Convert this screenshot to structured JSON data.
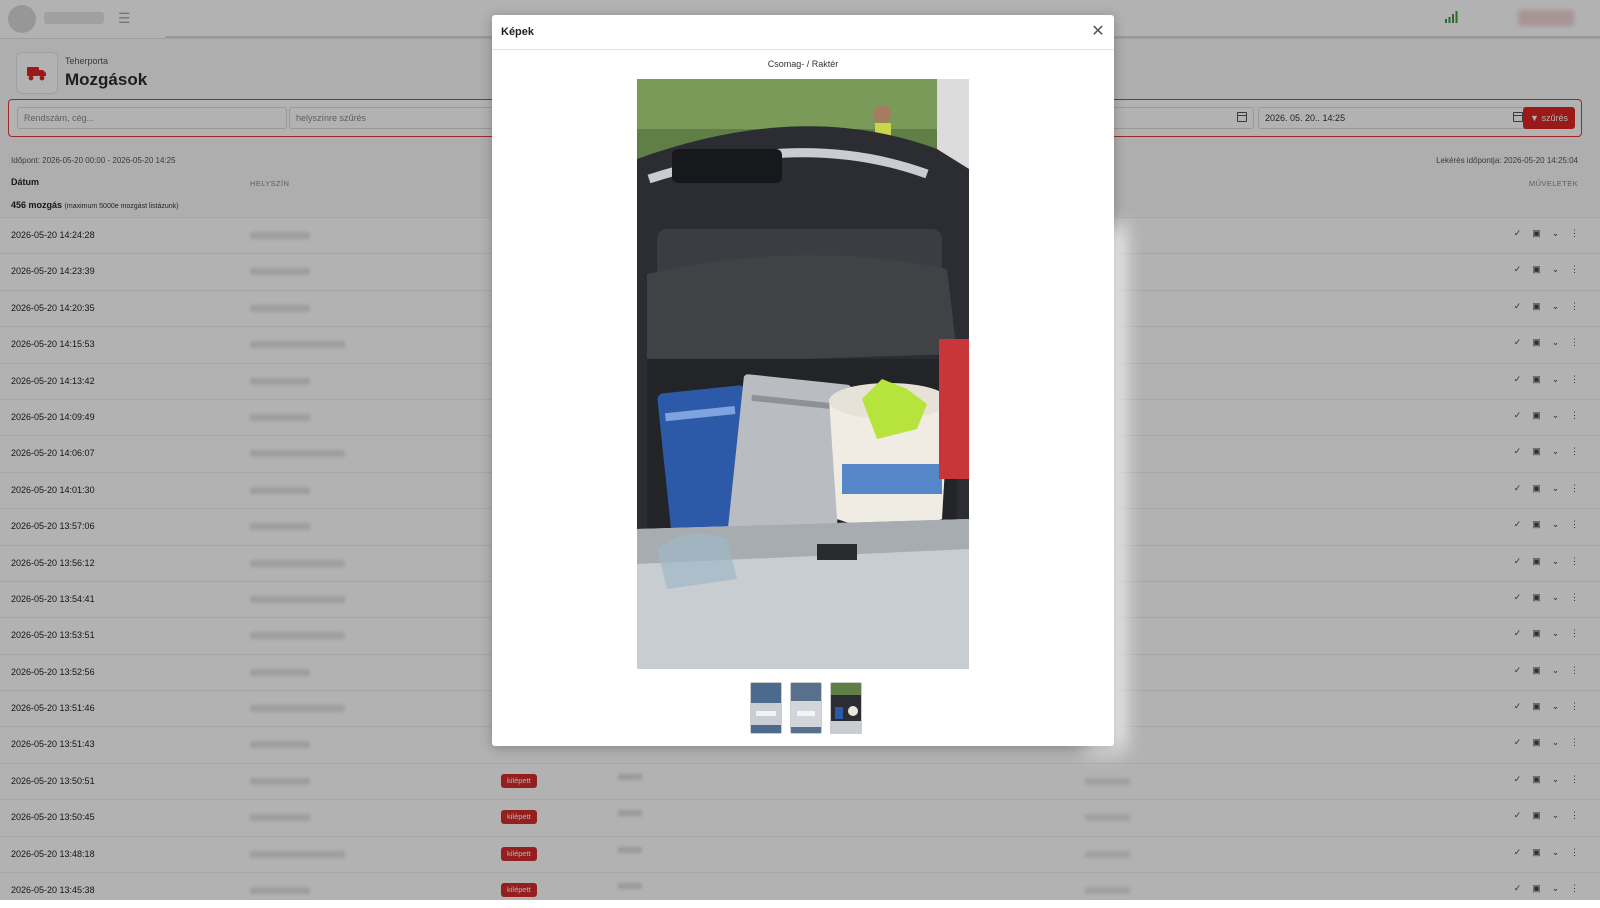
{
  "header": {
    "breadcrumb": "Teherporta",
    "title": "Mozgások"
  },
  "filters": {
    "search_placeholder": "Rendszám, cég...",
    "location_placeholder": "helyszínre szűrés",
    "date_to": "2026. 05. 20.. 14:25",
    "filter_button": "szűrés"
  },
  "meta": {
    "period": "Időpont: 2026-05-20 00:00 - 2026-05-20 14:25",
    "query_time": "Lekérés időpontja: 2026-05-20 14:25:04"
  },
  "table": {
    "col_date": "Dátum",
    "col_location": "HELYSZÍN",
    "col_actions": "MŰVELETEK",
    "count_main": "456 mozgás",
    "count_note": "(maximum 5000e mozgást listázunk)",
    "rows": [
      {
        "date": "2026-05-20 14:24:28"
      },
      {
        "date": "2026-05-20 14:23:39"
      },
      {
        "date": "2026-05-20 14:20:35"
      },
      {
        "date": "2026-05-20 14:15:53"
      },
      {
        "date": "2026-05-20 14:13:42"
      },
      {
        "date": "2026-05-20 14:09:49"
      },
      {
        "date": "2026-05-20 14:06:07"
      },
      {
        "date": "2026-05-20 14:01:30"
      },
      {
        "date": "2026-05-20 13:57:06"
      },
      {
        "date": "2026-05-20 13:56:12"
      },
      {
        "date": "2026-05-20 13:54:41"
      },
      {
        "date": "2026-05-20 13:53:51"
      },
      {
        "date": "2026-05-20 13:52:56"
      },
      {
        "date": "2026-05-20 13:51:46"
      },
      {
        "date": "2026-05-20 13:51:43"
      },
      {
        "date": "2026-05-20 13:50:51",
        "status": "kilépett"
      },
      {
        "date": "2026-05-20 13:50:45",
        "status": "kilépett"
      },
      {
        "date": "2026-05-20 13:48:18",
        "status": "kilépett"
      },
      {
        "date": "2026-05-20 13:45:38",
        "status": "kilépett"
      }
    ]
  },
  "modal": {
    "title": "Képek",
    "close_icon": "close-icon",
    "photo_label": "Csomag- / Raktér"
  },
  "colors": {
    "accent": "#e02424",
    "badge": "#d62d2d"
  }
}
